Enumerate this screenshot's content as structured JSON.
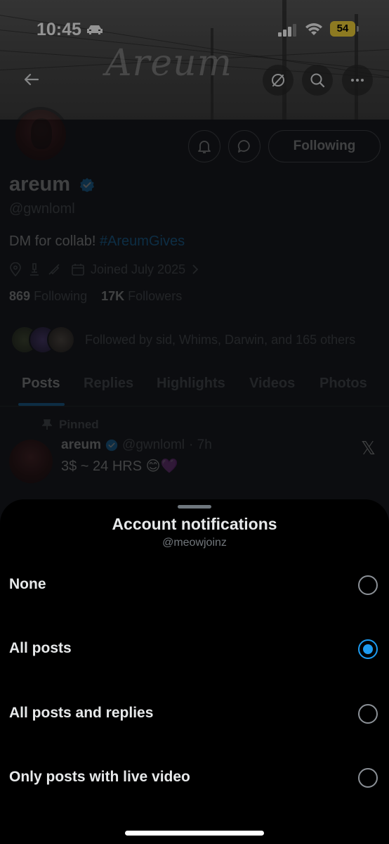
{
  "status_bar": {
    "time": "10:45",
    "battery": "54",
    "car_icon": "car-icon",
    "signal_icon": "cellular-signal-icon",
    "wifi_icon": "wifi-icon"
  },
  "banner": {
    "signature_text": "Areum"
  },
  "nav": {
    "back_icon": "back-arrow-icon",
    "grok_icon": "grok-icon",
    "search_icon": "search-icon",
    "more_icon": "more-icon"
  },
  "profile": {
    "name": "areum",
    "handle": "@gwnloml",
    "bio_text": "DM for collab! ",
    "bio_hashtag": "#AreumGives",
    "joined": "Joined July 2025",
    "following_count": "869",
    "following_label": "Following",
    "followers_count": "17K",
    "followers_label": "Followers",
    "followed_by": "Followed by sid, Whims, Darwin, and 165 others",
    "following_button": "Following"
  },
  "tabs": [
    "Posts",
    "Replies",
    "Highlights",
    "Videos",
    "Photos"
  ],
  "active_tab": "Posts",
  "pinned_post": {
    "pinned_label": "Pinned",
    "author": "areum",
    "handle": "@gwnloml",
    "time": "· 7h",
    "text": "3$ ~ 24 HRS 😊💜"
  },
  "sheet": {
    "title": "Account notifications",
    "subtitle": "@meowjoinz",
    "options": [
      {
        "label": "None",
        "selected": false
      },
      {
        "label": "All posts",
        "selected": true
      },
      {
        "label": "All posts and replies",
        "selected": false
      },
      {
        "label": "Only posts with live video",
        "selected": false
      }
    ]
  },
  "colors": {
    "accent": "#1d9bf0",
    "background": "#000000",
    "secondary_text": "#71767b",
    "battery": "#f3d23a"
  }
}
